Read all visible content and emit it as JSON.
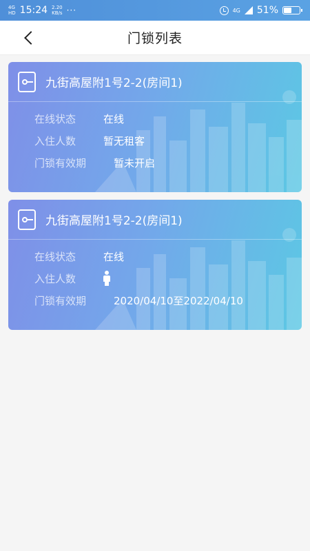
{
  "status_bar": {
    "network_top": "4G",
    "network_bottom": "HD",
    "time": "15:24",
    "speed_value": "2.20",
    "speed_unit": "KB/s",
    "dots": "···",
    "signal_label": "4G",
    "battery_percent": "51%",
    "battery_level": 0.51
  },
  "nav": {
    "title": "门锁列表",
    "back_icon": "chevron-left-icon"
  },
  "cards": [
    {
      "title": "九街高屋附1号2-2(房间1)",
      "status_label": "在线状态",
      "status_value": "在线",
      "occupants_label": "入住人数",
      "occupants_value": "暂无租客",
      "validity_label": "门锁有效期",
      "validity_value": "暂未开启"
    },
    {
      "title": "九街高屋附1号2-2(房间1)",
      "status_label": "在线状态",
      "status_value": "在线",
      "occupants_label": "入住人数",
      "occupants_value": "",
      "occupants_icon": "person-icon",
      "validity_label": "门锁有效期",
      "validity_value": "2020/04/10至2022/04/10"
    }
  ]
}
